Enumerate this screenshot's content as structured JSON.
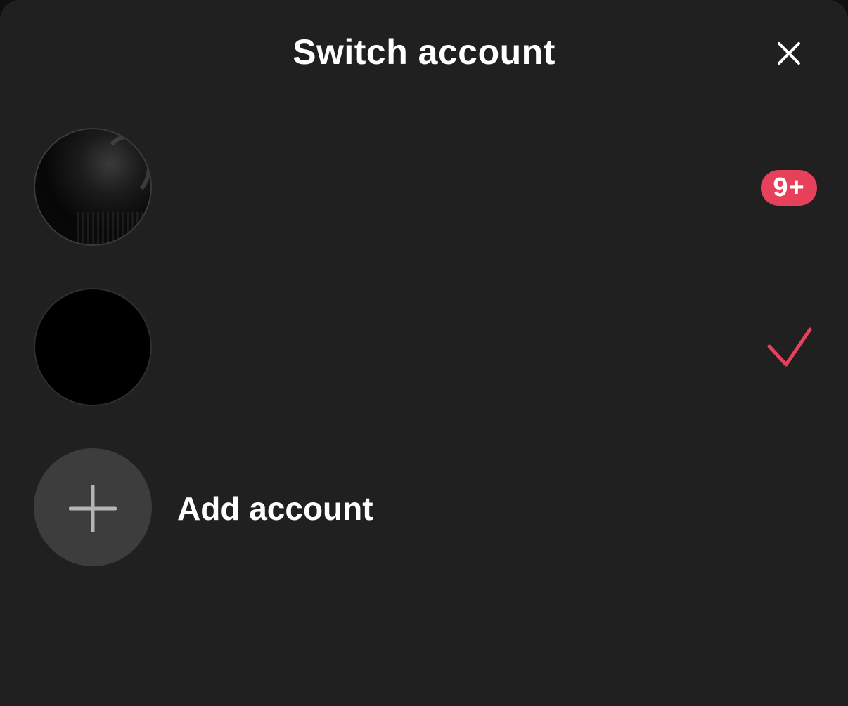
{
  "dialog": {
    "title": "Switch account",
    "close_icon": "close-icon"
  },
  "accounts": [
    {
      "name": "",
      "notification_badge": "9+",
      "selected": false
    },
    {
      "name": "",
      "selected": true,
      "selected_icon": "checkmark-icon"
    }
  ],
  "add_account": {
    "label": "Add account",
    "icon": "plus-icon"
  },
  "colors": {
    "background": "#202020",
    "accent": "#e6405a",
    "add_circle": "#3d3d3d",
    "text": "#ffffff"
  }
}
